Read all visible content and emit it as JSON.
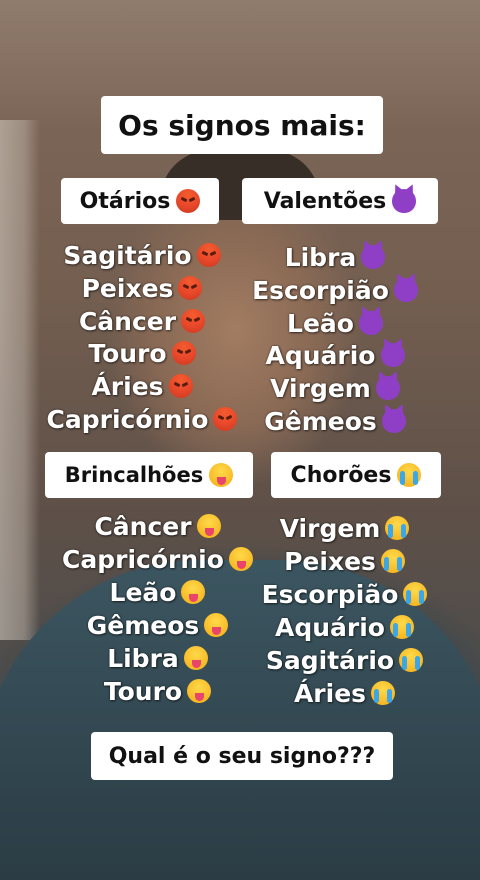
{
  "title": "Os signos mais:",
  "categories": {
    "otarios": "Otários",
    "valentoes": "Valentões",
    "brincalhoes": "Brincalhões",
    "choroes": "Chorões"
  },
  "icons": {
    "otarios": "angry-face-icon",
    "valentoes": "smiling-devil-icon",
    "brincalhoes": "winking-tongue-face-icon",
    "choroes": "loudly-crying-face-icon"
  },
  "lists": {
    "otarios": [
      "Sagitário",
      "Peixes",
      "Câncer",
      "Touro",
      "Áries",
      "Capricórnio"
    ],
    "valentoes": [
      "Libra",
      "Escorpião",
      "Leão",
      "Aquário",
      "Virgem",
      "Gêmeos"
    ],
    "brincalhoes": [
      "Câncer",
      "Capricórnio",
      "Leão",
      "Gêmeos",
      "Libra",
      "Touro"
    ],
    "choroes": [
      "Virgem",
      "Peixes",
      "Escorpião",
      "Aquário",
      "Sagitário",
      "Áries"
    ]
  },
  "question": "Qual é o seu signo???"
}
